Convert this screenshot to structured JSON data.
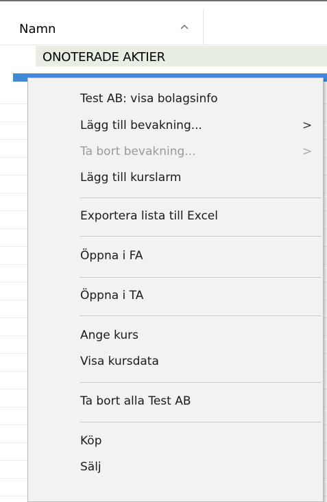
{
  "grid": {
    "column_header": "Namn",
    "sort_icon": "chevron-up-icon",
    "group_label": "ONOTERADE AKTIER"
  },
  "context_menu": {
    "items": [
      {
        "label": "Test AB: visa bolagsinfo"
      },
      {
        "label": "Lägg till bevakning...",
        "submenu": ">"
      },
      {
        "label": "Ta bort bevakning...",
        "submenu": ">",
        "disabled": true
      },
      {
        "label": "Lägg till kurslarm"
      },
      {
        "label": "Exportera lista till Excel"
      },
      {
        "label": "Öppna i FA"
      },
      {
        "label": "Öppna i TA"
      },
      {
        "label": "Ange kurs"
      },
      {
        "label": "Visa kursdata"
      },
      {
        "label": "Ta bort alla Test AB"
      },
      {
        "label": "Köp"
      },
      {
        "label": "Sälj"
      }
    ]
  },
  "colors": {
    "selection": "#3f89dd",
    "group_row": "#e8efe2",
    "menu_bg": "#f2f2f2"
  }
}
